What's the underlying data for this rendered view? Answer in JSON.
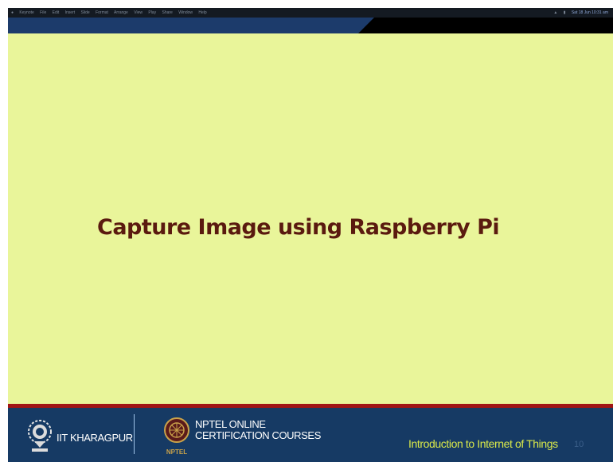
{
  "menubar": {
    "app_name": "Keynote",
    "menus": [
      "File",
      "Edit",
      "Insert",
      "Slide",
      "Format",
      "Arrange",
      "View",
      "Play",
      "Share",
      "Window",
      "Help"
    ],
    "status_items": [
      "Wi-Fi",
      "Battery"
    ],
    "clock": "Sat 18 Jun 10:31 am"
  },
  "slide": {
    "title": "Capture Image using Raspberry Pi"
  },
  "footer": {
    "institute": "IIT KHARAGPUR",
    "nptel_line1": "NPTEL ONLINE",
    "nptel_line2": "CERTIFICATION COURSES",
    "nptel_logo_text": "NPTEL",
    "course_title": "Introduction to Internet of Things",
    "slide_number": "10"
  },
  "colors": {
    "slide_background": "#e9f59a",
    "title_color": "#5a1a0f",
    "footer_background": "#163a64",
    "red_stripe": "#a01515",
    "course_title_color": "#d9e84a"
  },
  "icons": {
    "iit_logo": "iit-kharagpur-emblem-icon",
    "nptel_logo": "nptel-logo-icon",
    "apple": "apple-icon"
  }
}
